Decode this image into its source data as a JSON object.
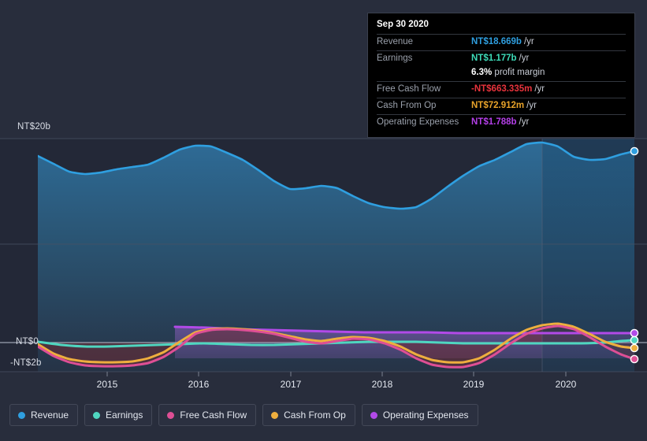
{
  "background": "#282d3c",
  "tooltip": {
    "date": "Sep 30 2020",
    "rows": [
      {
        "key": "Revenue",
        "value": "NT$18.669b",
        "unit": "/yr",
        "color": "#2f9fe0"
      },
      {
        "key": "Earnings",
        "value": "NT$1.177b",
        "unit": "/yr",
        "color": "#3ddbb8"
      },
      {
        "key": "Free Cash Flow",
        "value": "-NT$663.335m",
        "unit": "/yr",
        "color": "#e8333c"
      },
      {
        "key": "Cash From Op",
        "value": "NT$72.912m",
        "unit": "/yr",
        "color": "#e8a32a"
      },
      {
        "key": "Operating Expenses",
        "value": "NT$1.788b",
        "unit": "/yr",
        "color": "#b43fe8"
      }
    ],
    "profit_margin_value": "6.3%",
    "profit_margin_label": "profit margin"
  },
  "legend": {
    "items": [
      {
        "label": "Revenue",
        "color": "#2f9fe0"
      },
      {
        "label": "Earnings",
        "color": "#4fd6c0"
      },
      {
        "label": "Free Cash Flow",
        "color": "#de4f95"
      },
      {
        "label": "Cash From Op",
        "color": "#eeae3e"
      },
      {
        "label": "Operating Expenses",
        "color": "#b24ae8"
      }
    ]
  },
  "chart_data": {
    "type": "area",
    "title": "",
    "xlabel": "",
    "ylabel": "",
    "grid": true,
    "legend_position": "bottom",
    "currency": "NT$",
    "y_axis": {
      "ticks": [
        {
          "label": "NT$20b",
          "value": 20,
          "y": 176
        },
        {
          "label": "NT$0",
          "value": 0,
          "y": 435
        },
        {
          "label": "-NT$2b",
          "value": -2,
          "y": 462
        }
      ],
      "ylim": [
        -2.6,
        20.8
      ],
      "gridlines_y": [
        176,
        310,
        435,
        472
      ]
    },
    "x_axis": {
      "tick_labels": [
        "2015",
        "2016",
        "2017",
        "2018",
        "2019",
        "2020"
      ],
      "tick_x": [
        136,
        252,
        369,
        485,
        601,
        718
      ],
      "plot_left": 48,
      "plot_right": 805,
      "forecast_divider_x": 688
    },
    "series": [
      {
        "name": "Revenue",
        "color": "#2f9fe0",
        "filled": true,
        "end_value": "NT$18.669b",
        "points": [
          [
            48,
            198
          ],
          [
            68,
            208
          ],
          [
            88,
            218
          ],
          [
            108,
            221
          ],
          [
            128,
            219
          ],
          [
            148,
            215
          ],
          [
            168,
            212
          ],
          [
            188,
            209
          ],
          [
            208,
            200
          ],
          [
            228,
            190
          ],
          [
            248,
            185
          ],
          [
            268,
            186
          ],
          [
            288,
            194
          ],
          [
            308,
            203
          ],
          [
            328,
            216
          ],
          [
            348,
            230
          ],
          [
            368,
            240
          ],
          [
            388,
            239
          ],
          [
            408,
            236
          ],
          [
            428,
            239
          ],
          [
            448,
            249
          ],
          [
            468,
            258
          ],
          [
            488,
            263
          ],
          [
            508,
            265
          ],
          [
            528,
            263
          ],
          [
            548,
            252
          ],
          [
            568,
            237
          ],
          [
            588,
            223
          ],
          [
            608,
            211
          ],
          [
            628,
            203
          ],
          [
            648,
            193
          ],
          [
            668,
            183
          ],
          [
            688,
            181
          ],
          [
            708,
            186
          ],
          [
            728,
            199
          ],
          [
            748,
            203
          ],
          [
            768,
            202
          ],
          [
            788,
            196
          ],
          [
            805,
            192
          ]
        ]
      },
      {
        "name": "Earnings",
        "color": "#4fd6c0",
        "filled": false,
        "end_value": "NT$1.177b",
        "points": [
          [
            48,
            434
          ],
          [
            78,
            438
          ],
          [
            108,
            440
          ],
          [
            138,
            440
          ],
          [
            168,
            439
          ],
          [
            198,
            438
          ],
          [
            228,
            437
          ],
          [
            258,
            436
          ],
          [
            288,
            437
          ],
          [
            318,
            438
          ],
          [
            348,
            438
          ],
          [
            378,
            437
          ],
          [
            408,
            436
          ],
          [
            438,
            435
          ],
          [
            468,
            434
          ],
          [
            498,
            434
          ],
          [
            528,
            434
          ],
          [
            558,
            435
          ],
          [
            588,
            436
          ],
          [
            618,
            436
          ],
          [
            648,
            436
          ],
          [
            678,
            436
          ],
          [
            708,
            436
          ],
          [
            738,
            436
          ],
          [
            768,
            435
          ],
          [
            788,
            433
          ],
          [
            805,
            432
          ]
        ]
      },
      {
        "name": "Operating Expenses",
        "color": "#b24ae8",
        "filled": true,
        "end_value": "NT$1.788b",
        "points": [
          [
            222,
            415
          ],
          [
            262,
            416
          ],
          [
            302,
            418
          ],
          [
            342,
            419
          ],
          [
            382,
            420
          ],
          [
            422,
            421
          ],
          [
            462,
            422
          ],
          [
            502,
            422
          ],
          [
            542,
            422
          ],
          [
            582,
            423
          ],
          [
            622,
            423
          ],
          [
            662,
            423
          ],
          [
            702,
            423
          ],
          [
            742,
            423
          ],
          [
            772,
            423
          ],
          [
            805,
            423
          ]
        ]
      },
      {
        "name": "Free Cash Flow",
        "color": "#de4f95",
        "filled": false,
        "end_value": "-NT$663.335m",
        "points": [
          [
            48,
            440
          ],
          [
            68,
            452
          ],
          [
            88,
            460
          ],
          [
            108,
            464
          ],
          [
            128,
            465
          ],
          [
            148,
            465
          ],
          [
            168,
            464
          ],
          [
            188,
            461
          ],
          [
            208,
            453
          ],
          [
            228,
            440
          ],
          [
            248,
            424
          ],
          [
            268,
            419
          ],
          [
            288,
            418
          ],
          [
            308,
            419
          ],
          [
            328,
            421
          ],
          [
            348,
            424
          ],
          [
            368,
            429
          ],
          [
            388,
            434
          ],
          [
            408,
            436
          ],
          [
            428,
            433
          ],
          [
            448,
            430
          ],
          [
            468,
            431
          ],
          [
            488,
            436
          ],
          [
            508,
            444
          ],
          [
            528,
            455
          ],
          [
            548,
            463
          ],
          [
            568,
            466
          ],
          [
            588,
            466
          ],
          [
            608,
            461
          ],
          [
            628,
            450
          ],
          [
            648,
            436
          ],
          [
            668,
            424
          ],
          [
            688,
            417
          ],
          [
            708,
            414
          ],
          [
            728,
            418
          ],
          [
            748,
            428
          ],
          [
            768,
            440
          ],
          [
            788,
            450
          ],
          [
            805,
            456
          ]
        ]
      },
      {
        "name": "Cash From Op",
        "color": "#eeae3e",
        "filled": false,
        "end_value": "NT$72.912m",
        "points": [
          [
            48,
            437
          ],
          [
            68,
            449
          ],
          [
            88,
            456
          ],
          [
            108,
            459
          ],
          [
            128,
            460
          ],
          [
            148,
            460
          ],
          [
            168,
            459
          ],
          [
            188,
            455
          ],
          [
            208,
            447
          ],
          [
            228,
            434
          ],
          [
            248,
            422
          ],
          [
            268,
            418
          ],
          [
            288,
            417
          ],
          [
            308,
            418
          ],
          [
            328,
            420
          ],
          [
            348,
            423
          ],
          [
            368,
            427
          ],
          [
            388,
            431
          ],
          [
            408,
            433
          ],
          [
            428,
            430
          ],
          [
            448,
            428
          ],
          [
            468,
            429
          ],
          [
            488,
            433
          ],
          [
            508,
            440
          ],
          [
            528,
            450
          ],
          [
            548,
            457
          ],
          [
            568,
            460
          ],
          [
            588,
            460
          ],
          [
            608,
            455
          ],
          [
            628,
            444
          ],
          [
            648,
            430
          ],
          [
            668,
            419
          ],
          [
            688,
            413
          ],
          [
            708,
            411
          ],
          [
            728,
            415
          ],
          [
            748,
            424
          ],
          [
            768,
            434
          ],
          [
            788,
            440
          ],
          [
            805,
            442
          ]
        ]
      }
    ],
    "end_markers": [
      {
        "series": "Revenue",
        "x": 805,
        "y": 192,
        "color": "#2f9fe0"
      },
      {
        "series": "Operating Expenses",
        "x": 805,
        "y": 423,
        "color": "#b24ae8"
      },
      {
        "series": "Earnings",
        "x": 805,
        "y": 432,
        "color": "#4fd6c0"
      },
      {
        "series": "Cash From Op",
        "x": 805,
        "y": 442,
        "color": "#eeae3e"
      },
      {
        "series": "Free Cash Flow",
        "x": 805,
        "y": 456,
        "color": "#de4f95"
      }
    ]
  }
}
